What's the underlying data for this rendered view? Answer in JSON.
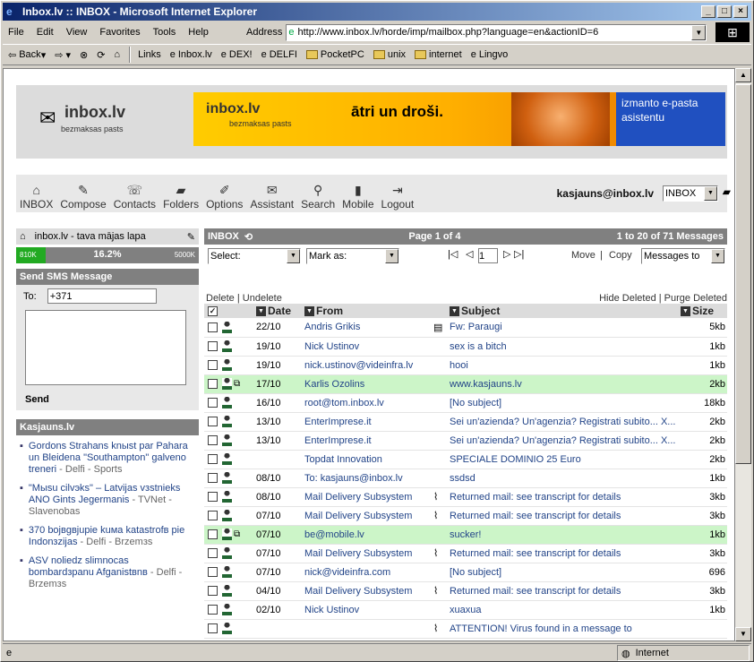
{
  "window": {
    "title": "Inbox.lv :: INBOX - Microsoft Internet Explorer"
  },
  "menu": [
    "File",
    "Edit",
    "View",
    "Favorites",
    "Tools",
    "Help"
  ],
  "address": {
    "label": "Address",
    "url": "http://www.inbox.lv/horde/imp/mailbox.php?language=en&actionID=6"
  },
  "toolbar": {
    "back": "Back",
    "links_label": "Links",
    "links": [
      "Inbox.lv",
      "DEX!",
      "DELFI",
      "PocketPC",
      "unix",
      "internet",
      "Lingvo"
    ]
  },
  "header": {
    "logo": "inbox.lv",
    "logo_sub": "bezmaksas pasts",
    "banner_logo": "inbox.lv",
    "banner_sub": "bezmaksas pasts",
    "banner_text": "ātri un droši.",
    "banner_side": "izmanto e-pasta asistentu"
  },
  "nav": [
    "INBOX",
    "Compose",
    "Contacts",
    "Folders",
    "Options",
    "Assistant",
    "Search",
    "Mobile",
    "Logout"
  ],
  "user": "kasjauns@inbox.lv",
  "folder_select": "INBOX",
  "left": {
    "home_link": "inbox.lv - tava mājas lapa",
    "quota_min": "810K",
    "quota_pct": "16.2%",
    "quota_max": "5000K",
    "quota_fraction": 0.162,
    "sms_title": "Send SMS Message",
    "to_label": "To:",
    "to_value": "+371",
    "send": "Send",
    "news_title": "Kasjauns.lv",
    "news": [
      {
        "title": "Gordons Strahans knыst par Pahara un Bleidena \"Southampton\" galveno treneri",
        "src": "- Delfi - Sports"
      },
      {
        "title": "\"Mыsu cilvэks\" – Latvijas vзstnieks ANO Gints Jegermanis",
        "src": "- TVNet - Slavenobas"
      },
      {
        "title": "370 bojвgвjupie kuмa katastrofв pie Indonзzijas",
        "src": "- Delfi - Brzemзs"
      },
      {
        "title": "ASV noliedz slimnocas bombardзpanu Afganistвnв",
        "src": "- Delfi - Brzemзs"
      }
    ]
  },
  "mailbox": {
    "name": "INBOX",
    "page": "Page 1 of 4",
    "count": "1 to 20 of 71 Messages",
    "select": "Select:",
    "mark": "Mark as:",
    "page_input": "1",
    "move": "Move",
    "copy": "Copy",
    "messages_to": "Messages to",
    "delete": "Delete",
    "undelete": "Undelete",
    "hide_deleted": "Hide Deleted",
    "purge_deleted": "Purge Deleted",
    "cols": {
      "date": "Date",
      "from": "From",
      "subject": "Subject",
      "size": "Size"
    },
    "rows": [
      {
        "date": "22/10",
        "from": "Andris Grikis",
        "subject": "Fw: Paraugi",
        "size": "5kb",
        "hl": false,
        "att": "doc",
        "fwd": false
      },
      {
        "date": "19/10",
        "from": "Nick Ustinov",
        "subject": "sex is a bitch",
        "size": "1kb",
        "hl": false,
        "att": "",
        "fwd": false
      },
      {
        "date": "19/10",
        "from": "nick.ustinov@videinfra.lv",
        "subject": "hooi",
        "size": "1kb",
        "hl": false,
        "att": "",
        "fwd": false
      },
      {
        "date": "17/10",
        "from": "Karlis Ozolins",
        "subject": "www.kasjauns.lv",
        "size": "2kb",
        "hl": true,
        "att": "",
        "fwd": true
      },
      {
        "date": "16/10",
        "from": "root@tom.inbox.lv",
        "subject": "[No subject]",
        "size": "18kb",
        "hl": false,
        "att": "",
        "fwd": false
      },
      {
        "date": "13/10",
        "from": "EnterImprese.it",
        "subject": "Sei un'azienda? Un'agenzia? Registrati subito... X...",
        "size": "2kb",
        "hl": false,
        "att": "",
        "fwd": false
      },
      {
        "date": "13/10",
        "from": "EnterImprese.it",
        "subject": "Sei un'azienda? Un'agenzia? Registrati subito... X...",
        "size": "2kb",
        "hl": false,
        "att": "",
        "fwd": false
      },
      {
        "date": "",
        "from": "Topdat Innovation",
        "subject": "SPECIALE DOMINIO 25 Euro",
        "size": "2kb",
        "hl": false,
        "att": "",
        "fwd": false
      },
      {
        "date": "08/10",
        "from": "To: kasjauns@inbox.lv",
        "subject": "ssdsd",
        "size": "1kb",
        "hl": false,
        "att": "",
        "fwd": false
      },
      {
        "date": "08/10",
        "from": "Mail Delivery Subsystem",
        "subject": "Returned mail: see transcript for details",
        "size": "3kb",
        "hl": false,
        "att": "clip",
        "fwd": false
      },
      {
        "date": "07/10",
        "from": "Mail Delivery Subsystem",
        "subject": "Returned mail: see transcript for details",
        "size": "3kb",
        "hl": false,
        "att": "clip",
        "fwd": false
      },
      {
        "date": "07/10",
        "from": "be@mobile.lv",
        "subject": "sucker!",
        "size": "1kb",
        "hl": true,
        "att": "",
        "fwd": true
      },
      {
        "date": "07/10",
        "from": "Mail Delivery Subsystem",
        "subject": "Returned mail: see transcript for details",
        "size": "3kb",
        "hl": false,
        "att": "clip",
        "fwd": false
      },
      {
        "date": "07/10",
        "from": "nick@videinfra.com",
        "subject": "[No subject]",
        "size": "696",
        "hl": false,
        "att": "",
        "fwd": false
      },
      {
        "date": "04/10",
        "from": "Mail Delivery Subsystem",
        "subject": "Returned mail: see transcript for details",
        "size": "3kb",
        "hl": false,
        "att": "clip",
        "fwd": false
      },
      {
        "date": "02/10",
        "from": "Nick Ustinov",
        "subject": "xuaxua",
        "size": "1kb",
        "hl": false,
        "att": "",
        "fwd": false
      },
      {
        "date": "",
        "from": "",
        "subject": "ATTENTION! Virus found in a message to",
        "size": "",
        "hl": false,
        "att": "clip",
        "fwd": false
      }
    ]
  },
  "status": {
    "zone": "Internet"
  }
}
